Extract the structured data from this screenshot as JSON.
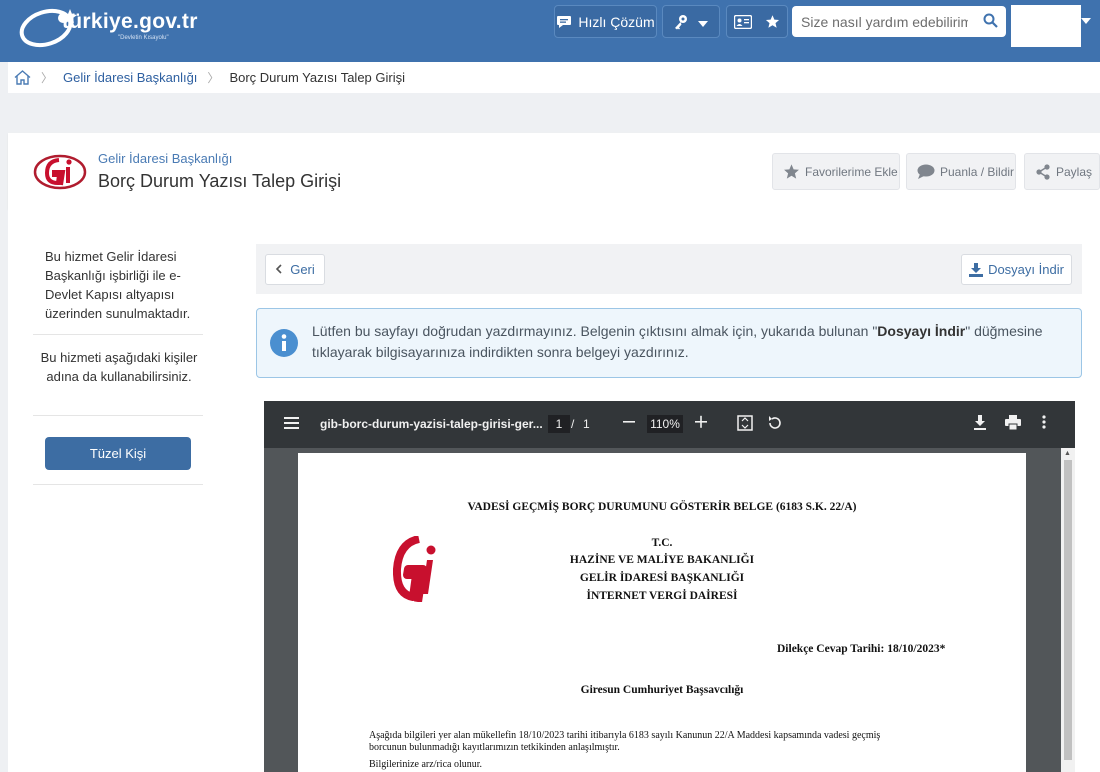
{
  "header": {
    "logo_text": "türkiye.gov.tr",
    "logo_subtext": "\"Devletin Kısayolu\"",
    "hizli_cozum": "Hızlı Çözüm",
    "search_placeholder": "Size nasıl yardım edebilirim?"
  },
  "breadcrumb": {
    "home_icon": "home-icon",
    "items": [
      "Gelir İdaresi Başkanlığı",
      "Borç Durum Yazısı Talep Girişi"
    ]
  },
  "page_header": {
    "parent": "Gelir İdaresi Başkanlığı",
    "title": "Borç Durum Yazısı Talep Girişi",
    "favorite_label": "Favorilerime Ekle",
    "rate_label": "Puanla / Bildir",
    "share_label": "Paylaş"
  },
  "sidebar": {
    "text1": "Bu hizmet Gelir İdaresi Başkanlığı işbirliği ile e-Devlet Kapısı altyapısı üzerinden sunulmaktadır.",
    "text2": "Bu hizmeti aşağıdaki kişiler adına da kullanabilirsiniz.",
    "button_label": "Tüzel Kişi"
  },
  "main": {
    "back_label": "Geri",
    "download_label": "Dosyayı İndir",
    "info_before": "Lütfen bu sayfayı doğrudan yazdırmayınız. Belgenin çıktısını almak için, yukarıda bulunan \"",
    "info_bold": "Dosyayı İndir",
    "info_after": "\" düğmesine tıklayarak bilgisayarınıza indirdikten sonra belgeyi yazdırınız."
  },
  "pdf_viewer": {
    "filename": "gib-borc-durum-yazisi-talep-girisi-ger...",
    "page_current": "1",
    "page_separator": "/",
    "page_total": "1",
    "zoom": "110%",
    "document": {
      "heading": "VADESİ GEÇMİŞ BORÇ DURUMUNU GÖSTERİR BELGE (6183 S.K. 22/A)",
      "tc": "T.C.",
      "ministry": "HAZİNE VE MALİYE BAKANLIĞI",
      "gib": "GELİR İDARESİ BAŞKANLIĞI",
      "ivd": "İNTERNET VERGİ DAİRESİ",
      "date_line": "Dilekçe Cevap Tarihi: 18/10/2023*",
      "recipient": "Giresun Cumhuriyet Başsavcılığı",
      "body_line1": "Aşağıda bilgileri yer alan mükellefin 18/10/2023 tarihi itibarıyla 6183 sayılı Kanunun 22/A Maddesi kapsamında vadesi geçmiş",
      "body_line2": "borcunun bulunmadığı kayıtlarımızın tetkikinden anlaşılmıştır.",
      "body_line3": "Bilgilerinize arz/rica olunur."
    }
  },
  "colors": {
    "topbar": "#3f72ae",
    "primary_button": "#3d6da3",
    "link": "#2d5fa0",
    "gib_red": "#c8102e"
  }
}
